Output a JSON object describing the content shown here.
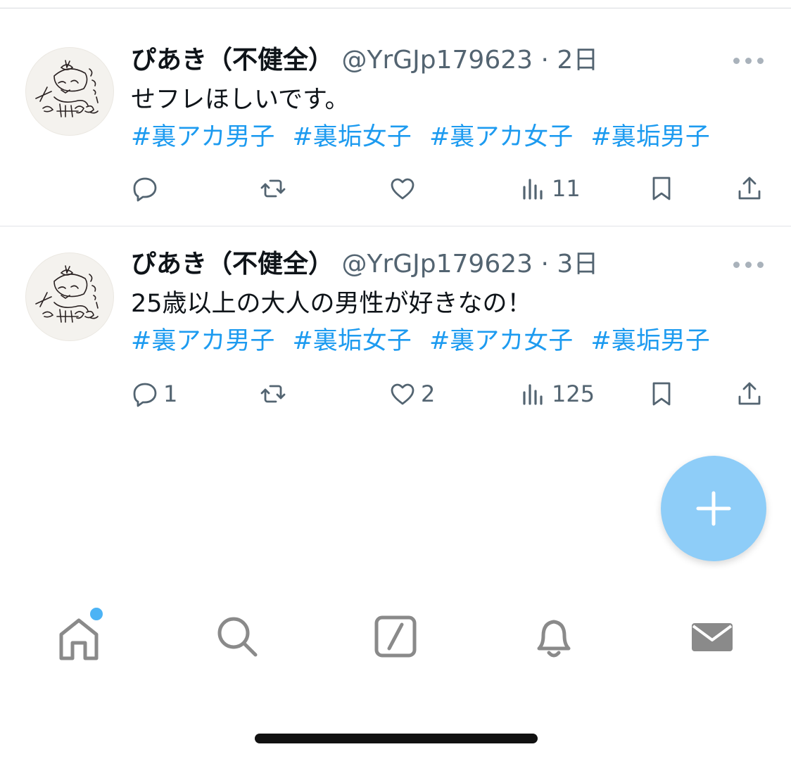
{
  "tweets": [
    {
      "name": "ぴあき（不健全）",
      "handle": "@YrGJp179623",
      "separator": "·",
      "time": "2日",
      "text": "せフレほしいです。",
      "hashtags": [
        "#裏アカ男子",
        "#裏垢女子",
        "#裏アカ女子",
        "#裏垢男子"
      ],
      "replies": "",
      "retweets": "",
      "likes": "",
      "views": "11"
    },
    {
      "name": "ぴあき（不健全）",
      "handle": "@YrGJp179623",
      "separator": "·",
      "time": "3日",
      "text": "25歳以上の大人の男性が好きなの！",
      "hashtags": [
        "#裏アカ男子",
        "#裏垢女子",
        "#裏アカ女子",
        "#裏垢男子"
      ],
      "replies": "1",
      "retweets": "",
      "likes": "2",
      "views": "125"
    }
  ],
  "icons": {
    "reply": "reply-icon",
    "retweet": "retweet-icon",
    "like": "heart-icon",
    "views": "views-icon",
    "bookmark": "bookmark-icon",
    "share": "share-icon",
    "more": "more-icon",
    "compose": "plus-icon"
  },
  "tabbar": [
    "home-icon",
    "search-icon",
    "grok-icon",
    "bell-icon",
    "mail-icon"
  ],
  "colors": {
    "hashtag": "#1d9bf0",
    "secondary_text": "#536471",
    "fab": "#8ecdf8",
    "tab_icon": "#8a8a8a",
    "notification_dot": "#4cb3f5"
  }
}
